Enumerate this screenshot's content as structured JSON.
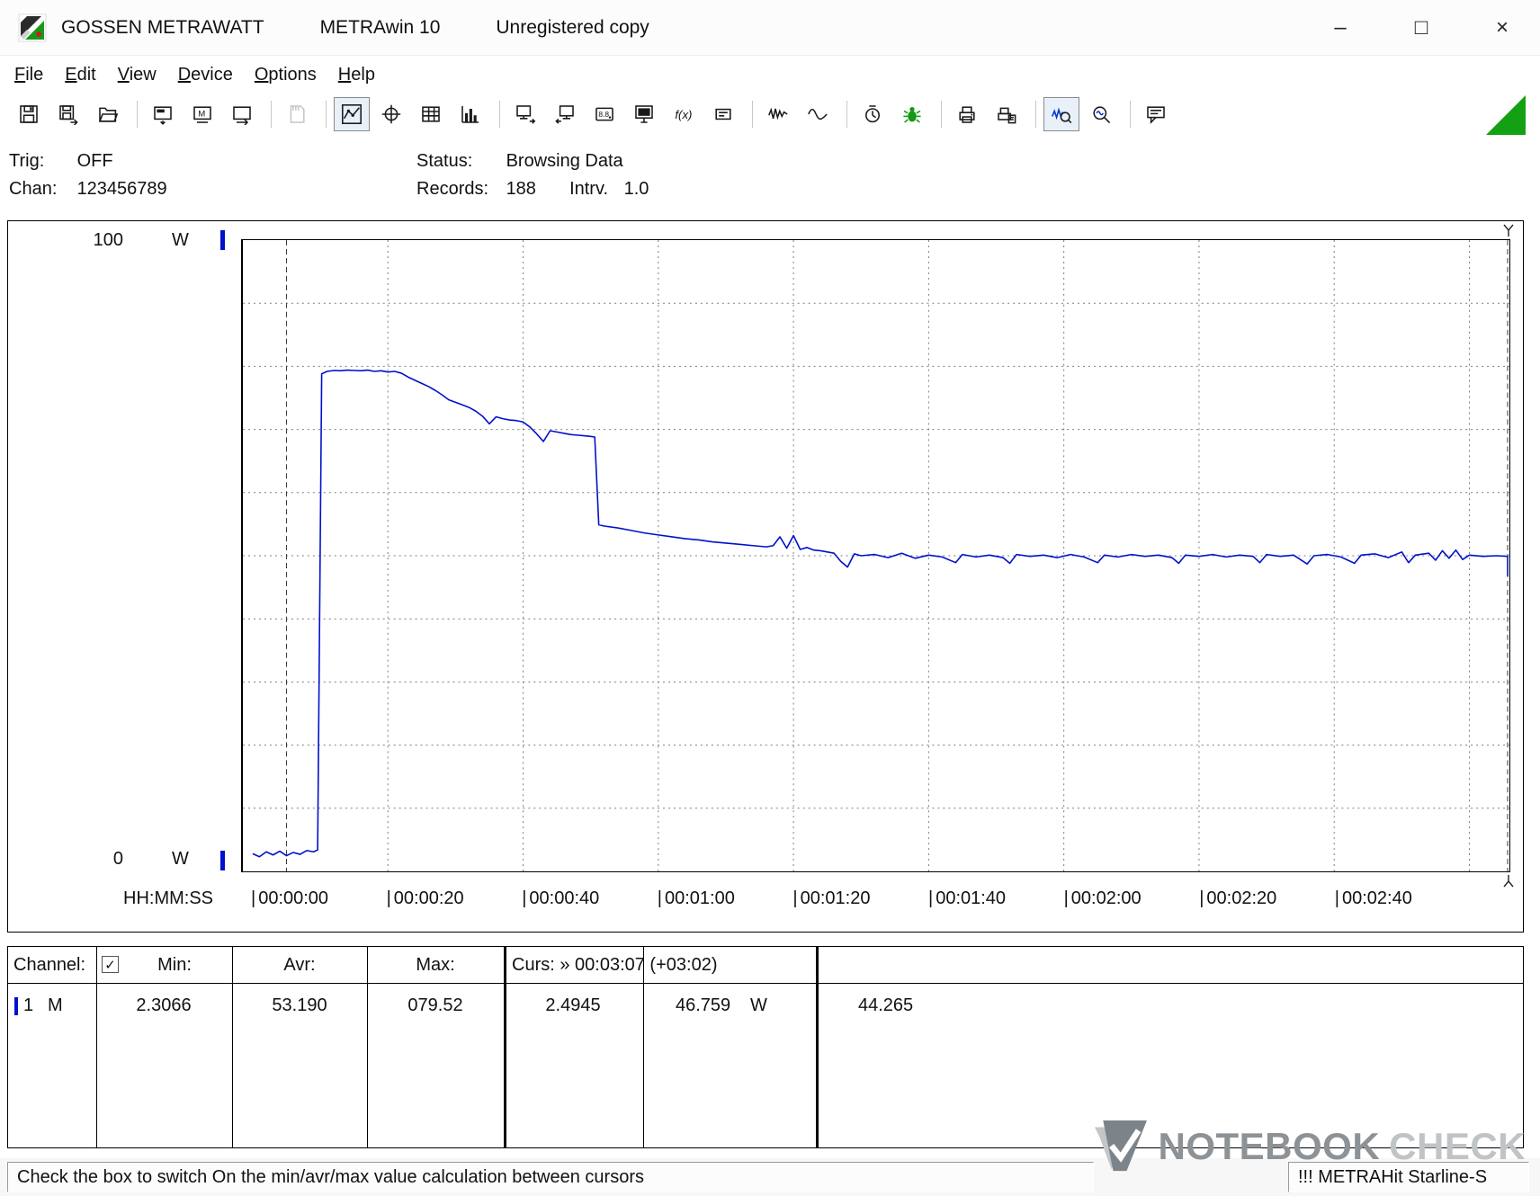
{
  "window": {
    "brand": "GOSSEN METRAWATT",
    "app": "METRAwin 10",
    "license": "Unregistered copy",
    "minimize": "–",
    "maximize": "□",
    "close": "×"
  },
  "menu": {
    "items": [
      "File",
      "Edit",
      "View",
      "Device",
      "Options",
      "Help"
    ]
  },
  "toolbar": {
    "groups": [
      [
        "save",
        "save-as",
        "open"
      ],
      [
        "read-device",
        "device-memory",
        "device-transfer"
      ],
      [
        "memory-card"
      ],
      [
        "trend-chart",
        "crosshair",
        "table-view",
        "bar-chart"
      ],
      [
        "display-export",
        "display-import",
        "multimeter",
        "monitor",
        "formula",
        "mini-display"
      ],
      [
        "signal-noise",
        "signal-smooth"
      ],
      [
        "timer",
        "bug"
      ],
      [
        "print",
        "print-setup"
      ],
      [
        "zoom-signal",
        "zoom"
      ],
      [
        "annotation"
      ]
    ],
    "active": [
      "trend-chart",
      "zoom-signal"
    ],
    "disabled": [
      "memory-card"
    ]
  },
  "status_panel": {
    "trig_label": "Trig:",
    "trig_value": "OFF",
    "chan_label": "Chan:",
    "chan_value": "123456789",
    "status_label": "Status:",
    "status_value": "Browsing Data",
    "records_label": "Records:",
    "records_value": "188",
    "interval_label": "Intrv.",
    "interval_value": "1.0"
  },
  "chart": {
    "y_max": "100",
    "y_min": "0",
    "y_unit": "W",
    "x_label": "HH:MM:SS"
  },
  "chart_data": {
    "type": "line",
    "title": "",
    "xlabel": "HH:MM:SS",
    "ylabel": "W",
    "ylim": [
      0,
      100
    ],
    "x_range_s": [
      0,
      188
    ],
    "x_gridline_step_s": 20,
    "y_gridline_step_w": 10,
    "grid": true,
    "records": 188,
    "interval_s": 1.0,
    "x_tick_labels": [
      "00:00:00",
      "00:00:20",
      "00:00:40",
      "00:01:00",
      "00:01:20",
      "00:01:40",
      "00:02:00",
      "00:02:20",
      "00:02:40"
    ],
    "cursors": [
      {
        "time": "00:00:05",
        "time_s": 5,
        "value_w": 2.4945
      },
      {
        "time": "00:03:07",
        "time_s": 187,
        "value_w": 46.759
      }
    ],
    "stats": {
      "min_w": 2.3066,
      "avr_w": 53.19,
      "max_w": 79.52,
      "delta_w": 44.265
    },
    "series": [
      {
        "name": "Channel 1 (W)",
        "color": "#0011cc",
        "points": [
          [
            0,
            2.8
          ],
          [
            1,
            2.31
          ],
          [
            2,
            3.1
          ],
          [
            3,
            2.6
          ],
          [
            4,
            3.2
          ],
          [
            5,
            2.49
          ],
          [
            6,
            3.0
          ],
          [
            7,
            2.7
          ],
          [
            8,
            3.3
          ],
          [
            9,
            3.1
          ],
          [
            9.6,
            3.4
          ],
          [
            10.2,
            78.8
          ],
          [
            11,
            79.2
          ],
          [
            12,
            79.35
          ],
          [
            13,
            79.3
          ],
          [
            14,
            79.4
          ],
          [
            15,
            79.35
          ],
          [
            16,
            79.3
          ],
          [
            17,
            79.4
          ],
          [
            18,
            79.2
          ],
          [
            19,
            79.3
          ],
          [
            20,
            79.1
          ],
          [
            21,
            79.2
          ],
          [
            22,
            78.9
          ],
          [
            23,
            78.3
          ],
          [
            24,
            77.8
          ],
          [
            25,
            77.3
          ],
          [
            26,
            76.8
          ],
          [
            27,
            76.2
          ],
          [
            28,
            75.5
          ],
          [
            29,
            74.7
          ],
          [
            30,
            74.3
          ],
          [
            31,
            73.9
          ],
          [
            32,
            73.5
          ],
          [
            33,
            72.9
          ],
          [
            34,
            72.1
          ],
          [
            35,
            70.9
          ],
          [
            36,
            72.0
          ],
          [
            37,
            71.7
          ],
          [
            38,
            71.5
          ],
          [
            39,
            71.4
          ],
          [
            40,
            71.2
          ],
          [
            41,
            70.4
          ],
          [
            42,
            69.3
          ],
          [
            43,
            68.1
          ],
          [
            44,
            69.8
          ],
          [
            45,
            69.6
          ],
          [
            46,
            69.4
          ],
          [
            47,
            69.2
          ],
          [
            48,
            69.1
          ],
          [
            49,
            69.0
          ],
          [
            50,
            68.9
          ],
          [
            50.6,
            68.8
          ],
          [
            51.2,
            54.9
          ],
          [
            52,
            54.7
          ],
          [
            54,
            54.4
          ],
          [
            56,
            54.0
          ],
          [
            58,
            53.6
          ],
          [
            60,
            53.3
          ],
          [
            62,
            53.0
          ],
          [
            64,
            52.7
          ],
          [
            66,
            52.5
          ],
          [
            68,
            52.2
          ],
          [
            70,
            52.0
          ],
          [
            72,
            51.8
          ],
          [
            74,
            51.6
          ],
          [
            76,
            51.4
          ],
          [
            77,
            51.6
          ],
          [
            78,
            53.0
          ],
          [
            79,
            51.2
          ],
          [
            80,
            53.2
          ],
          [
            81,
            51.0
          ],
          [
            82,
            51.3
          ],
          [
            83,
            50.9
          ],
          [
            84,
            50.8
          ],
          [
            85,
            50.6
          ],
          [
            86,
            50.4
          ],
          [
            87,
            49.1
          ],
          [
            88,
            48.2
          ],
          [
            89,
            50.3
          ],
          [
            90,
            50.0
          ],
          [
            92,
            50.2
          ],
          [
            94,
            49.7
          ],
          [
            96,
            50.4
          ],
          [
            98,
            49.6
          ],
          [
            100,
            50.1
          ],
          [
            102,
            49.8
          ],
          [
            104,
            48.9
          ],
          [
            105,
            50.2
          ],
          [
            107,
            49.8
          ],
          [
            109,
            50.1
          ],
          [
            111,
            49.7
          ],
          [
            112,
            48.8
          ],
          [
            113,
            50.2
          ],
          [
            115,
            49.9
          ],
          [
            117,
            50.1
          ],
          [
            119,
            49.7
          ],
          [
            121,
            50.2
          ],
          [
            123,
            49.8
          ],
          [
            125,
            48.9
          ],
          [
            126,
            50.1
          ],
          [
            128,
            49.8
          ],
          [
            130,
            50.2
          ],
          [
            132,
            49.9
          ],
          [
            134,
            50.1
          ],
          [
            136,
            49.7
          ],
          [
            137,
            48.8
          ],
          [
            138,
            50.1
          ],
          [
            140,
            49.9
          ],
          [
            142,
            50.2
          ],
          [
            144,
            49.8
          ],
          [
            146,
            50.1
          ],
          [
            148,
            49.9
          ],
          [
            149,
            48.9
          ],
          [
            150,
            50.2
          ],
          [
            152,
            49.9
          ],
          [
            154,
            50.1
          ],
          [
            156,
            48.7
          ],
          [
            157,
            50.0
          ],
          [
            159,
            50.2
          ],
          [
            161,
            49.8
          ],
          [
            163,
            48.8
          ],
          [
            164,
            50.1
          ],
          [
            166,
            50.3
          ],
          [
            168,
            49.7
          ],
          [
            170,
            50.6
          ],
          [
            171,
            48.9
          ],
          [
            172,
            50.1
          ],
          [
            174,
            50.4
          ],
          [
            175,
            49.3
          ],
          [
            176,
            50.8
          ],
          [
            177,
            49.6
          ],
          [
            178,
            50.9
          ],
          [
            179,
            49.4
          ],
          [
            180,
            50.1
          ],
          [
            182,
            49.9
          ],
          [
            184,
            50.0
          ],
          [
            186,
            49.9
          ],
          [
            187,
            46.76
          ]
        ]
      }
    ]
  },
  "table": {
    "channel_label": "Channel:",
    "checkbox_checked": true,
    "check_glyph": "✓",
    "min_label": "Min:",
    "avr_label": "Avr:",
    "max_label": "Max:",
    "cursor_label": "Curs: » 00:03:07 (+03:02)",
    "row": {
      "channel": "1",
      "mode": "M",
      "min": "2.3066",
      "avr": "53.190",
      "max": "079.52",
      "cursor1": "2.4945",
      "cursor2": "46.759",
      "cursor2_unit": "W",
      "delta": "44.265"
    }
  },
  "statusbar": {
    "hint": "Check the box to switch On the min/avr/max value calculation between cursors",
    "device": "!!! METRAHit Starline-S"
  },
  "watermark": {
    "word1": "NOTEBOOK",
    "word2": "CHECK"
  }
}
